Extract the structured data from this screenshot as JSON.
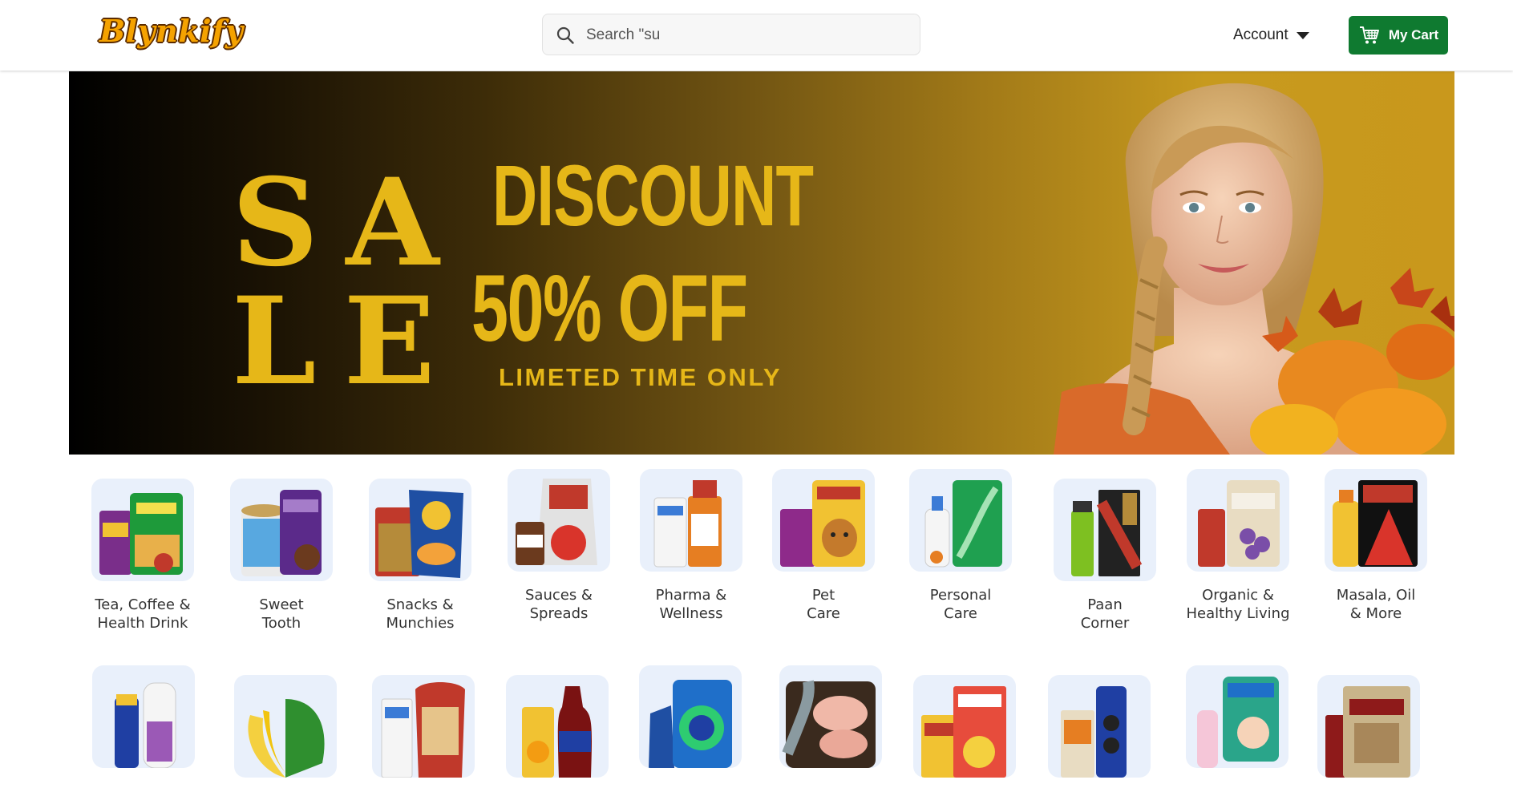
{
  "header": {
    "logo_text": "Blynkify",
    "search_placeholder": "Search \"su",
    "account_label": "Account",
    "cart_label": "My Cart"
  },
  "banner": {
    "sale_line1": "SA",
    "sale_line2": "LE",
    "discount": "DISCOUNT",
    "off": "50% OFF",
    "limited": "LIMETED TIME ONLY"
  },
  "categories_row1": [
    {
      "line1": "Tea, Coffee &",
      "line2": "Health Drink",
      "icon": "tea-coffee-icon"
    },
    {
      "line1": "Sweet",
      "line2": "Tooth",
      "icon": "sweet-tooth-icon"
    },
    {
      "line1": "Snacks &",
      "line2": "Munchies",
      "icon": "snacks-icon"
    },
    {
      "line1": "Sauces &",
      "line2": "Spreads",
      "icon": "sauces-icon"
    },
    {
      "line1": "Pharma &",
      "line2": "Wellness",
      "icon": "pharma-icon"
    },
    {
      "line1": "Pet",
      "line2": "Care",
      "icon": "pet-care-icon"
    },
    {
      "line1": "Personal",
      "line2": "Care",
      "icon": "personal-care-icon"
    },
    {
      "line1": "Paan",
      "line2": "Corner",
      "icon": "paan-corner-icon"
    },
    {
      "line1": "Organic &",
      "line2": "Healthy Living",
      "icon": "organic-icon"
    },
    {
      "line1": "Masala, Oil",
      "line2": "& More",
      "icon": "masala-oil-icon"
    }
  ],
  "categories_row2": [
    {
      "icon": "stationery-icon"
    },
    {
      "icon": "vegetables-fruits-icon"
    },
    {
      "icon": "bakery-icon"
    },
    {
      "icon": "cold-drinks-icon"
    },
    {
      "icon": "cleaning-icon"
    },
    {
      "icon": "chicken-meat-fish-icon"
    },
    {
      "icon": "breakfast-icon"
    },
    {
      "icon": "biscuits-icon"
    },
    {
      "icon": "baby-care-icon"
    },
    {
      "icon": "atta-rice-icon"
    }
  ],
  "colors": {
    "accent_green": "#0f7a30",
    "banner_gold": "#e6b718",
    "tile_bg": "#e9f0fb"
  }
}
